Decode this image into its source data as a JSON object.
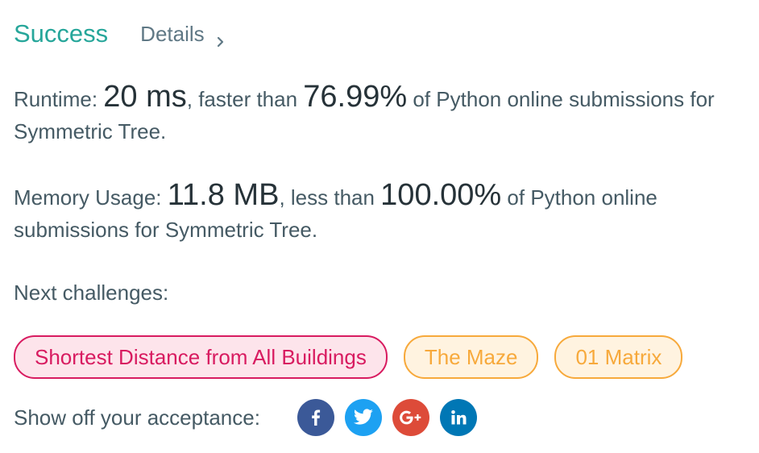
{
  "header": {
    "status": "Success",
    "details_label": "Details"
  },
  "runtime": {
    "label": "Runtime: ",
    "value": "20 ms",
    "mid": ", faster than ",
    "percent": "76.99%",
    "suffix": " of Python online submissions for Symmetric Tree."
  },
  "memory": {
    "label": "Memory Usage: ",
    "value": "11.8 MB",
    "mid": ", less than ",
    "percent": "100.00%",
    "suffix": " of Python online submissions for Symmetric Tree."
  },
  "next": {
    "label": "Next challenges:",
    "challenges": [
      {
        "title": "Shortest Distance from All Buildings",
        "difficulty": "hard"
      },
      {
        "title": "The Maze",
        "difficulty": "medium"
      },
      {
        "title": "01 Matrix",
        "difficulty": "medium"
      }
    ]
  },
  "share": {
    "label": "Show off your acceptance:",
    "networks": [
      {
        "name": "facebook-icon",
        "color": "#3b5998"
      },
      {
        "name": "twitter-icon",
        "color": "#1da1f2"
      },
      {
        "name": "google-plus-icon",
        "color": "#dd4b39"
      },
      {
        "name": "linkedin-icon",
        "color": "#0077b5"
      }
    ]
  },
  "colors": {
    "success": "#26a69a",
    "hard": "#d81b60",
    "medium": "#f7a93b"
  }
}
